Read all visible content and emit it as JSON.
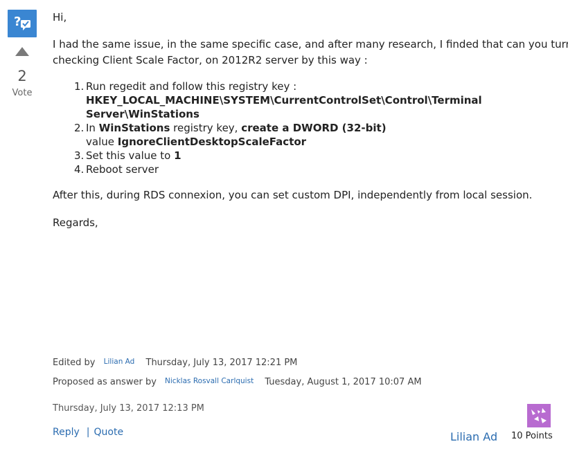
{
  "vote": {
    "count": "2",
    "label": "Vote"
  },
  "post": {
    "greeting": "Hi,",
    "intro_line1": "I had the same issue, in the same specific case, and after many research, I finded that can you turn off",
    "intro_line2": "checking Client Scale Factor, on 2012R2 server by this way :",
    "steps": [
      {
        "num": "1.",
        "text": "Run regedit and follow this registry key :",
        "key_line1": "HKEY_LOCAL_MACHINE\\SYSTEM\\CurrentControlSet\\Control\\Terminal",
        "key_line2": "Server\\WinStations"
      },
      {
        "num": "2.",
        "prefix": "In ",
        "bold1": "WinStations",
        "mid": " registry key, ",
        "bold2": "create a DWORD (32-bit)",
        "line2_prefix": "value ",
        "bold3": "IgnoreClientDesktopScaleFactor"
      },
      {
        "num": "3.",
        "text": "Set this value to ",
        "bold": "1"
      },
      {
        "num": "4.",
        "text": "Reboot server"
      }
    ],
    "after": "After this, during RDS connexion, you can set custom DPI, independently from local session.",
    "regards": "Regards,"
  },
  "meta": {
    "edited_label": "Edited by",
    "edited_user": "Lilian Ad",
    "edited_date": "Thursday, July 13, 2017 12:21 PM",
    "proposed_label": "Proposed as answer by",
    "proposed_user": "Nicklas Rosvall Carlquist",
    "proposed_date": "Tuesday, August 1, 2017 10:07 AM"
  },
  "timestamp": "Thursday, July 13, 2017 12:13 PM",
  "actions": {
    "reply": "Reply",
    "separator": "|",
    "quote": "Quote"
  },
  "author": {
    "name": "Lilian Ad",
    "points": "10 Points"
  },
  "colors": {
    "accent": "#3a86d2",
    "link": "#2b6cb0",
    "avatar": "#b86bd0"
  },
  "icons": {
    "question": "question-answered-icon",
    "upvote": "upvote-arrow-icon",
    "avatar": "user-avatar"
  }
}
